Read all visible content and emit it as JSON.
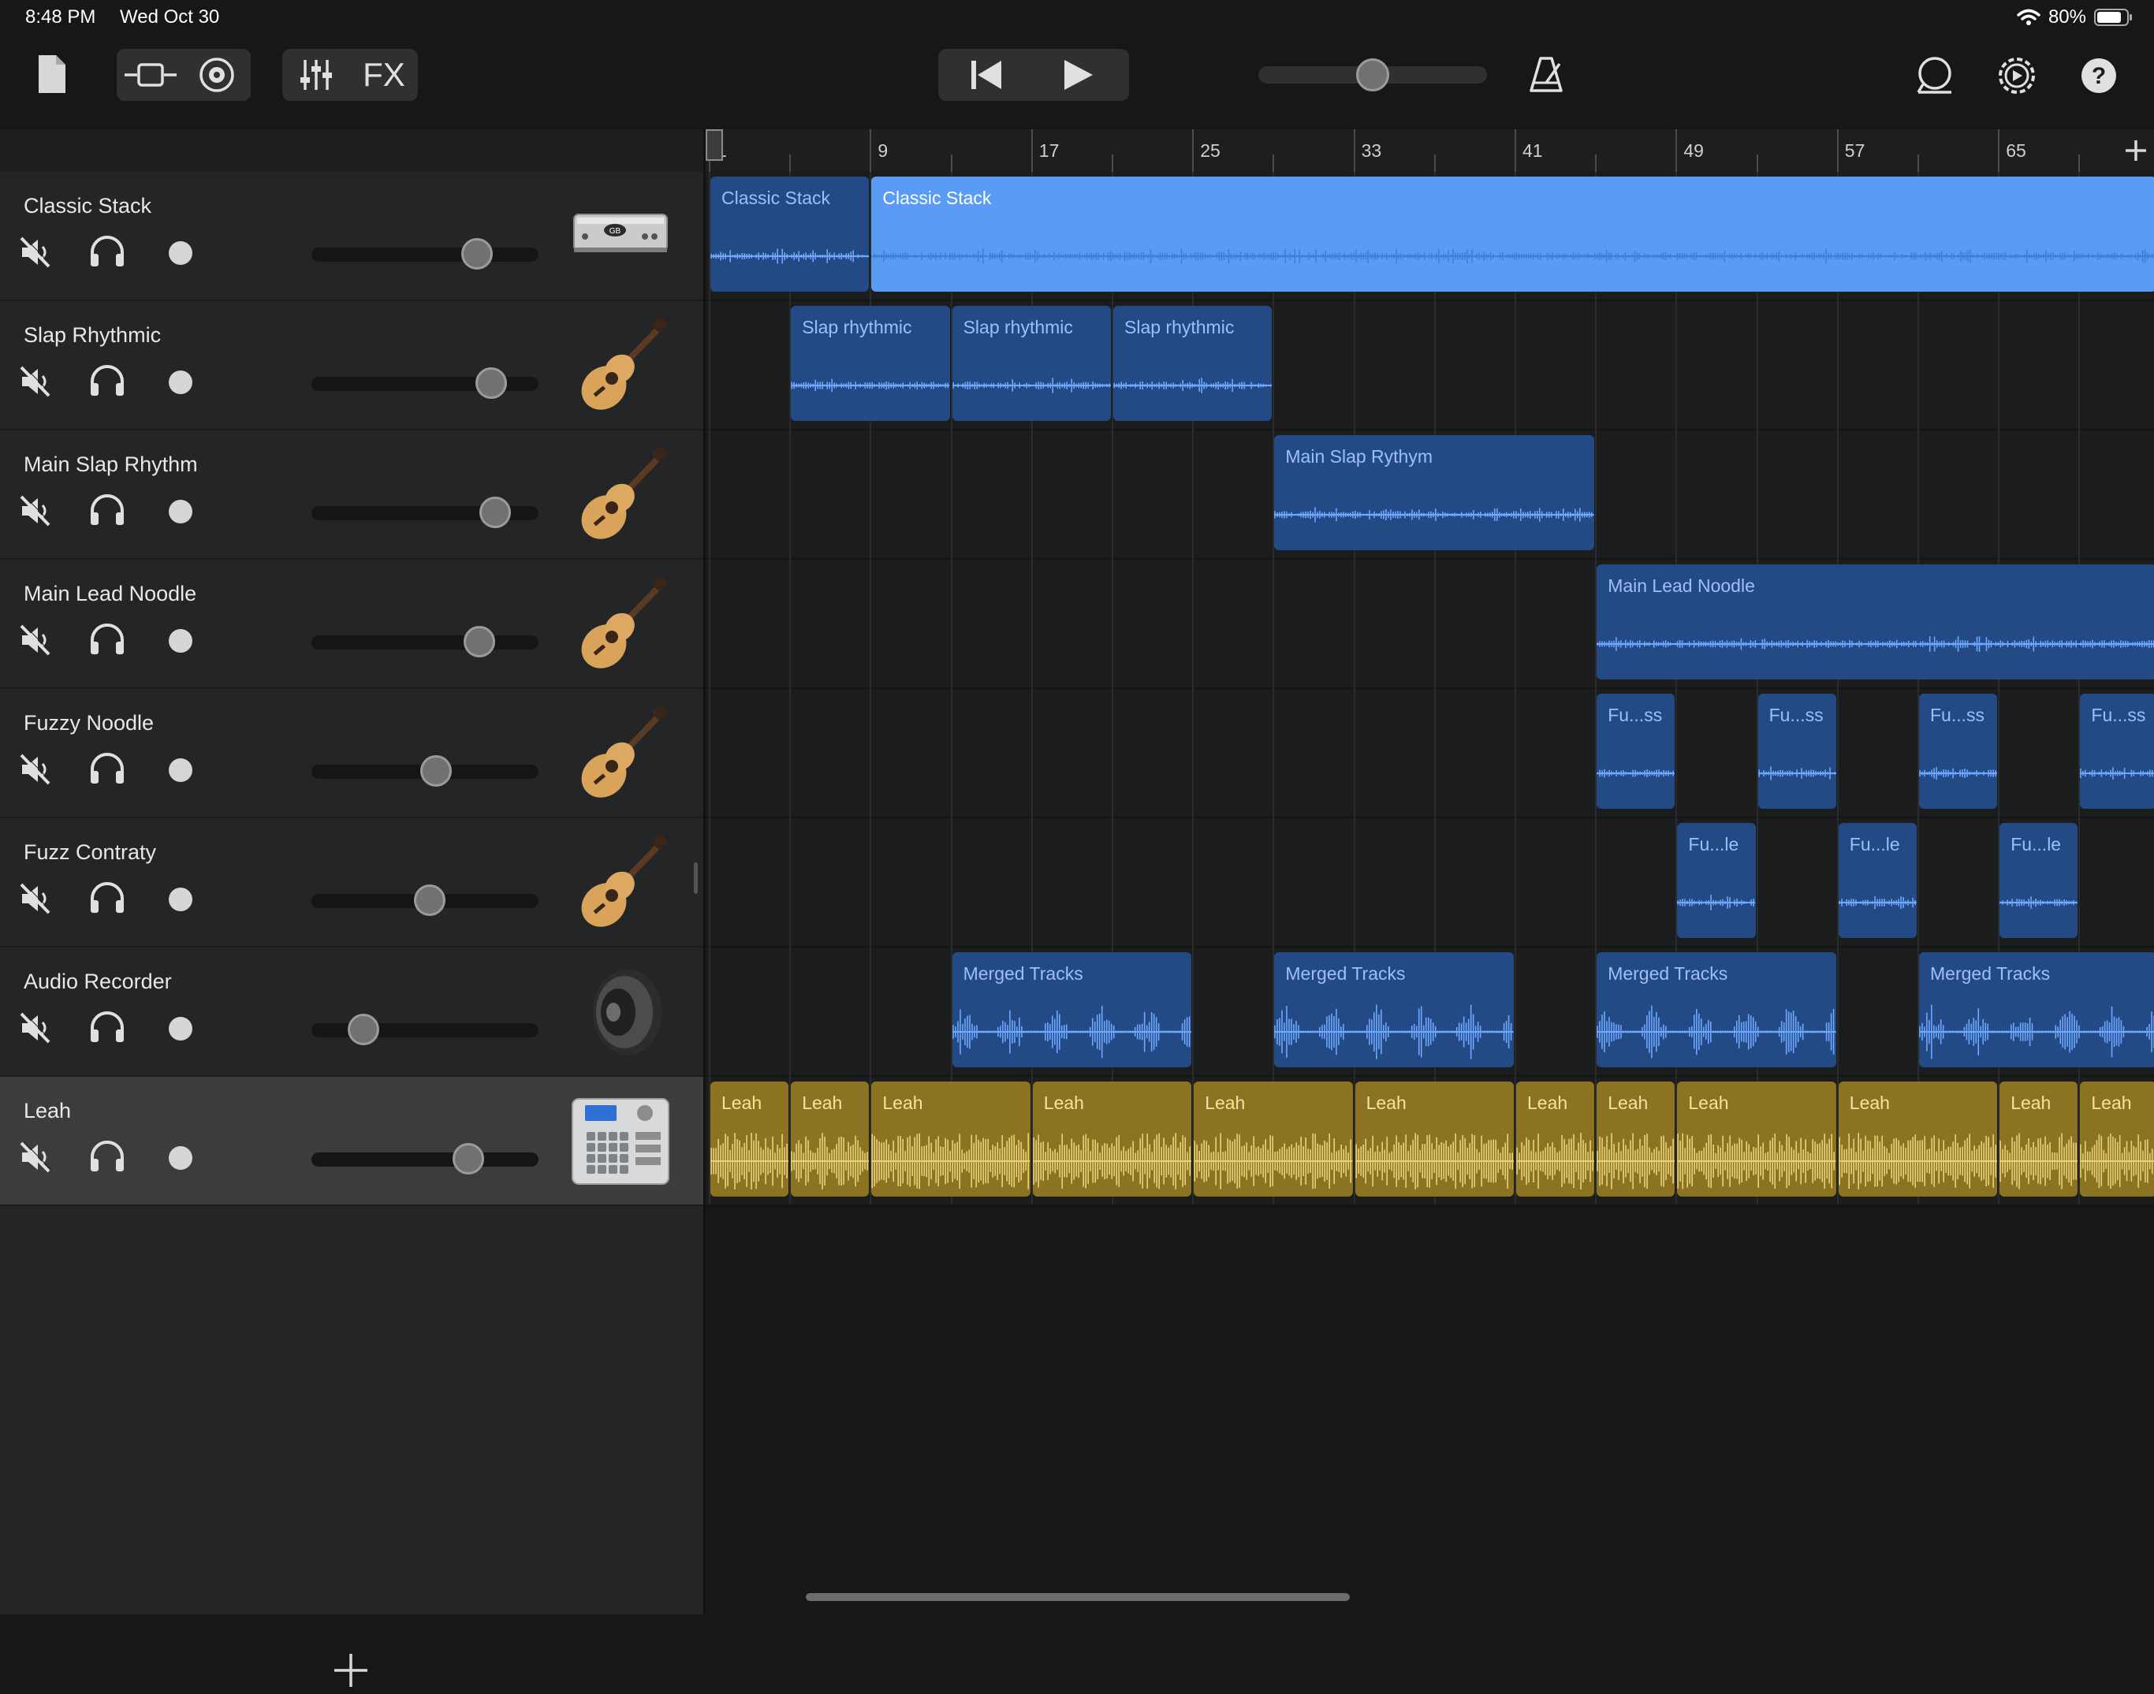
{
  "status": {
    "time": "8:48 PM",
    "date": "Wed Oct 30",
    "battery": "80%"
  },
  "toolbar": {
    "fx_label": "FX",
    "icons": [
      "document-icon",
      "tracks-view-icon",
      "live-loops-icon",
      "mixer-icon",
      "go-to-start-icon",
      "play-icon",
      "metronome-icon",
      "loop-icon",
      "settings-icon",
      "help-icon"
    ],
    "master_volume": 0.5
  },
  "ruler": {
    "bars": [
      "1",
      "9",
      "17",
      "25",
      "33",
      "41",
      "49",
      "57",
      "65"
    ]
  },
  "tracks": [
    {
      "name": "Classic Stack",
      "volume": 0.73,
      "instrument": "amp-head-icon"
    },
    {
      "name": "Slap Rhythmic",
      "volume": 0.79,
      "instrument": "acoustic-guitar-icon"
    },
    {
      "name": "Main Slap Rhythm",
      "volume": 0.81,
      "instrument": "acoustic-guitar-icon"
    },
    {
      "name": "Main Lead Noodle",
      "volume": 0.74,
      "instrument": "acoustic-guitar-icon"
    },
    {
      "name": "Fuzzy Noodle",
      "volume": 0.55,
      "instrument": "acoustic-guitar-icon"
    },
    {
      "name": "Fuzz Contraty",
      "volume": 0.52,
      "instrument": "acoustic-guitar-icon"
    },
    {
      "name": "Audio Recorder",
      "volume": 0.23,
      "instrument": "speaker-icon"
    },
    {
      "name": "Leah",
      "volume": 0.69,
      "instrument": "drum-machine-icon",
      "selected": true
    }
  ],
  "regions": [
    {
      "track": 0,
      "label": "Classic Stack",
      "start": 1,
      "end": 9,
      "style": "dark"
    },
    {
      "track": 0,
      "label": "Classic Stack",
      "start": 9,
      "end": 73,
      "style": "bright"
    },
    {
      "track": 1,
      "label": "Slap rhythmic",
      "start": 5,
      "end": 13,
      "style": "dark"
    },
    {
      "track": 1,
      "label": "Slap rhythmic",
      "start": 13,
      "end": 21,
      "style": "dark"
    },
    {
      "track": 1,
      "label": "Slap rhythmic",
      "start": 21,
      "end": 29,
      "style": "dark"
    },
    {
      "track": 2,
      "label": "Main Slap Rythym",
      "start": 29,
      "end": 45,
      "style": "dark"
    },
    {
      "track": 3,
      "label": "Main Lead Noodle",
      "start": 45,
      "end": 73,
      "style": "dark"
    },
    {
      "track": 4,
      "label": "Fu...ss",
      "start": 45,
      "end": 49,
      "style": "dark"
    },
    {
      "track": 4,
      "label": "Fu...ss",
      "start": 53,
      "end": 57,
      "style": "dark"
    },
    {
      "track": 4,
      "label": "Fu...ss",
      "start": 61,
      "end": 65,
      "style": "dark"
    },
    {
      "track": 4,
      "label": "Fu...ss",
      "start": 69,
      "end": 73,
      "style": "dark"
    },
    {
      "track": 5,
      "label": "Fu...le",
      "start": 49,
      "end": 53,
      "style": "dark"
    },
    {
      "track": 5,
      "label": "Fu...le",
      "start": 57,
      "end": 61,
      "style": "dark"
    },
    {
      "track": 5,
      "label": "Fu...le",
      "start": 65,
      "end": 69,
      "style": "dark"
    },
    {
      "track": 6,
      "label": "Merged Tracks",
      "start": 13,
      "end": 25,
      "style": "dark"
    },
    {
      "track": 6,
      "label": "Merged Tracks",
      "start": 29,
      "end": 41,
      "style": "dark"
    },
    {
      "track": 6,
      "label": "Merged Tracks",
      "start": 45,
      "end": 57,
      "style": "dark"
    },
    {
      "track": 6,
      "label": "Merged Tracks",
      "start": 61,
      "end": 73,
      "style": "dark"
    },
    {
      "track": 7,
      "label": "Leah",
      "start": 1,
      "end": 5,
      "style": "gold"
    },
    {
      "track": 7,
      "label": "Leah",
      "start": 5,
      "end": 9,
      "style": "gold"
    },
    {
      "track": 7,
      "label": "Leah",
      "start": 9,
      "end": 17,
      "style": "gold"
    },
    {
      "track": 7,
      "label": "Leah",
      "start": 17,
      "end": 25,
      "style": "gold"
    },
    {
      "track": 7,
      "label": "Leah",
      "start": 25,
      "end": 33,
      "style": "gold"
    },
    {
      "track": 7,
      "label": "Leah",
      "start": 33,
      "end": 41,
      "style": "gold"
    },
    {
      "track": 7,
      "label": "Leah",
      "start": 41,
      "end": 45,
      "style": "gold"
    },
    {
      "track": 7,
      "label": "Leah",
      "start": 45,
      "end": 49,
      "style": "gold"
    },
    {
      "track": 7,
      "label": "Leah",
      "start": 49,
      "end": 57,
      "style": "gold"
    },
    {
      "track": 7,
      "label": "Leah",
      "start": 57,
      "end": 65,
      "style": "gold"
    },
    {
      "track": 7,
      "label": "Leah",
      "start": 65,
      "end": 69,
      "style": "gold"
    },
    {
      "track": 7,
      "label": "Leah",
      "start": 69,
      "end": 73,
      "style": "gold"
    }
  ],
  "colors": {
    "region_dark": "#234a85",
    "region_dark_label": "#9cc0f5",
    "region_dark_wave": "#6ea8ff",
    "region_bright": "#5a9cf5",
    "region_bright_label": "#ffffff",
    "region_bright_wave": "#3e7fd6",
    "region_gold": "#8c7322",
    "region_gold_label": "#f3e3a0",
    "region_gold_wave": "#e9d17a"
  }
}
